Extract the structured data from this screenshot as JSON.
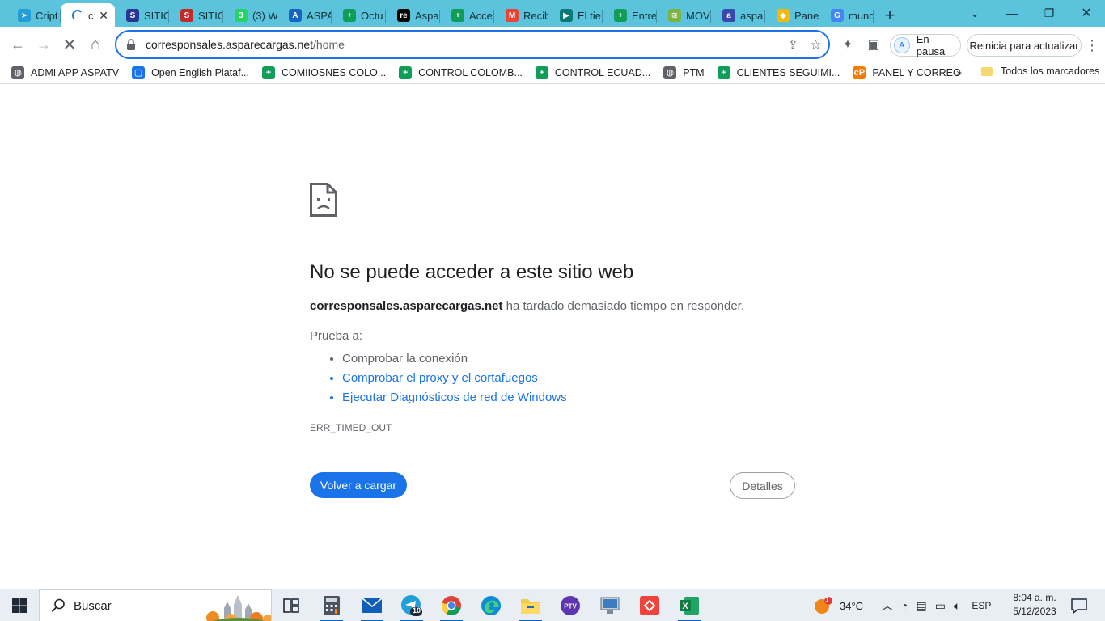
{
  "tabs": [
    {
      "label": "Cript",
      "color": "#229ed9",
      "glyph": "➤"
    },
    {
      "label": "c",
      "active": true,
      "close": "✕"
    },
    {
      "label": "SITIO",
      "color": "#283593",
      "glyph": "S"
    },
    {
      "label": "SITIO",
      "color": "#c62828",
      "glyph": "S"
    },
    {
      "label": "(3) W",
      "color": "#25d366",
      "glyph": "3"
    },
    {
      "label": "ASPA",
      "color": "#1565c0",
      "glyph": "A"
    },
    {
      "label": "Octu",
      "color": "#0f9d58",
      "glyph": "+"
    },
    {
      "label": "Aspa",
      "color": "#000000",
      "glyph": "re"
    },
    {
      "label": "Acce",
      "color": "#0f9d58",
      "glyph": "+"
    },
    {
      "label": "Recib",
      "color": "#ea4335",
      "glyph": "M"
    },
    {
      "label": "El tie",
      "color": "#0b7a75",
      "glyph": "▶"
    },
    {
      "label": "Entre",
      "color": "#0f9d58",
      "glyph": "+"
    },
    {
      "label": "MOV",
      "color": "#7cb342",
      "glyph": "≋"
    },
    {
      "label": "aspa",
      "color": "#3949ab",
      "glyph": "a"
    },
    {
      "label": "Panel",
      "color": "#f0b90b",
      "glyph": "◆"
    },
    {
      "label": "mund",
      "color": "#4285f4",
      "glyph": "G"
    }
  ],
  "newtab_label": "+",
  "window_controls": {
    "dropdown": "⌄",
    "minimize": "—",
    "restore": "❐",
    "close": "✕"
  },
  "toolbar": {
    "back": "←",
    "forward": "→",
    "stop": "✕",
    "home": "⌂",
    "url_host": "corresponsales.asparecargas.net",
    "url_path": "/home",
    "share_icon": "⇪",
    "star_icon": "☆",
    "extensions_icon": "✦",
    "sidepanel_icon": "▣",
    "profile_label": "En pausa",
    "update_label": "Reinicia para actualizar",
    "menu_icon": "⋮"
  },
  "bookmarks": [
    {
      "label": "ADMI APP ASPATV",
      "color": "#5f6368",
      "glyph": "◍"
    },
    {
      "label": "Open English Plataf...",
      "color": "#1a73e8",
      "glyph": "▢"
    },
    {
      "label": "COMIIOSNES COLO...",
      "color": "#0f9d58",
      "glyph": "+"
    },
    {
      "label": "CONTROL COLOMB...",
      "color": "#0f9d58",
      "glyph": "+"
    },
    {
      "label": "CONTROL  ECUAD...",
      "color": "#0f9d58",
      "glyph": "+"
    },
    {
      "label": "PTM",
      "color": "#5f6368",
      "glyph": "◍"
    },
    {
      "label": "CLIENTES SEGUIMI...",
      "color": "#0f9d58",
      "glyph": "+"
    },
    {
      "label": "PANEL Y CORREO",
      "color": "#f57c00",
      "glyph": "cP"
    }
  ],
  "bookmarks_more": "»",
  "bookmarks_all": "Todos los marcadores",
  "error": {
    "title": "No se puede acceder a este sitio web",
    "host": "corresponsales.asparecargas.net",
    "desc_rest": " ha tardado demasiado tiempo en responder.",
    "try_label": "Prueba a:",
    "suggestions": [
      {
        "text": "Comprobar la conexión",
        "link": false
      },
      {
        "text": "Comprobar el proxy y el cortafuegos",
        "link": true
      },
      {
        "text": "Ejecutar Diagnósticos de red de Windows",
        "link": true
      }
    ],
    "code": "ERR_TIMED_OUT",
    "reload_label": "Volver a cargar",
    "details_label": "Detalles"
  },
  "taskbar": {
    "search_placeholder": "Buscar",
    "telegram_badge": "10",
    "weather_badge": "1",
    "temperature": "34°C",
    "language": "ESP",
    "time": "8:04 a. m.",
    "date": "5/12/2023"
  },
  "colors": {
    "accent": "#1a73e8",
    "tabstrip": "#5cc3dd",
    "taskbar": "#e8eef4"
  }
}
